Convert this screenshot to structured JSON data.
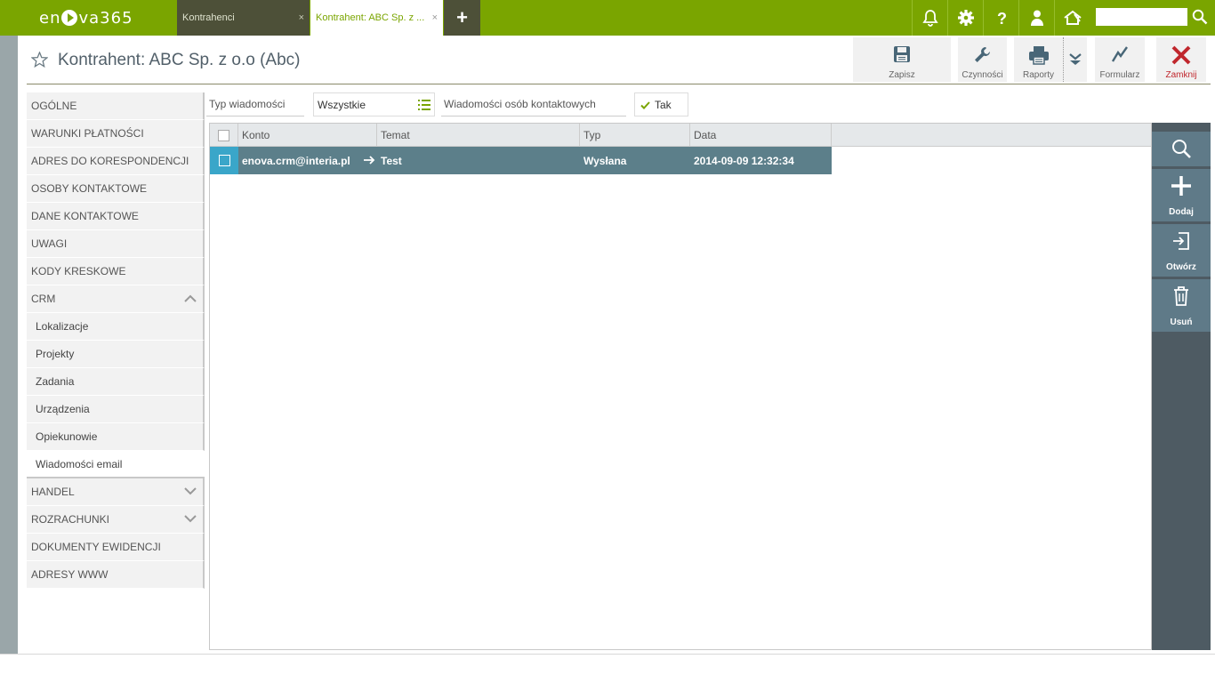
{
  "app": {
    "logo_text_left": "en",
    "logo_text_right": "va365"
  },
  "tabs": [
    {
      "label": "Kontrahenci",
      "close": "×"
    },
    {
      "label": "Kontrahent: ABC Sp. z ...",
      "close": "×"
    }
  ],
  "tab_add": "+",
  "header": {
    "title": "Kontrahent: ABC Sp. z o.o (Abc)"
  },
  "toolbar": {
    "save": "Zapisz",
    "actions": "Czynności",
    "reports": "Raporty",
    "form": "Formularz",
    "close": "Zamknij"
  },
  "sidebar": {
    "items": [
      {
        "label": "OGÓLNE"
      },
      {
        "label": "WARUNKI PŁATNOŚCI"
      },
      {
        "label": "ADRES DO KORESPONDENCJI"
      },
      {
        "label": "OSOBY KONTAKTOWE"
      },
      {
        "label": "DANE KONTAKTOWE"
      },
      {
        "label": "UWAGI"
      },
      {
        "label": "KODY KRESKOWE"
      },
      {
        "label": "CRM"
      },
      {
        "label": "Lokalizacje"
      },
      {
        "label": "Projekty"
      },
      {
        "label": "Zadania"
      },
      {
        "label": "Urządzenia"
      },
      {
        "label": "Opiekunowie"
      },
      {
        "label": "Wiadomości email"
      },
      {
        "label": "HANDEL"
      },
      {
        "label": "ROZRACHUNKI"
      },
      {
        "label": "DOKUMENTY EWIDENCJI"
      },
      {
        "label": "ADRESY WWW"
      }
    ]
  },
  "filters": {
    "type_label": "Typ wiadomości",
    "type_value": "Wszystkie",
    "contacts_label": "Wiadomości osób kontaktowych",
    "contacts_value": "Tak"
  },
  "grid": {
    "columns": [
      "Konto",
      "Temat",
      "Typ",
      "Data"
    ],
    "rows": [
      {
        "konto": "enova.crm@interia.pl",
        "temat": "Test",
        "typ": "Wysłana",
        "data": "2014-09-09 12:32:34"
      }
    ]
  },
  "right_panel": {
    "add": "Dodaj",
    "open": "Otwórz",
    "delete": "Usuń"
  },
  "colors": {
    "brand": "#7aa500",
    "dark_tab": "#4d5038",
    "selected_row": "#5c7f8a",
    "panel": "#4e5b63",
    "close_red": "#c0272d"
  }
}
